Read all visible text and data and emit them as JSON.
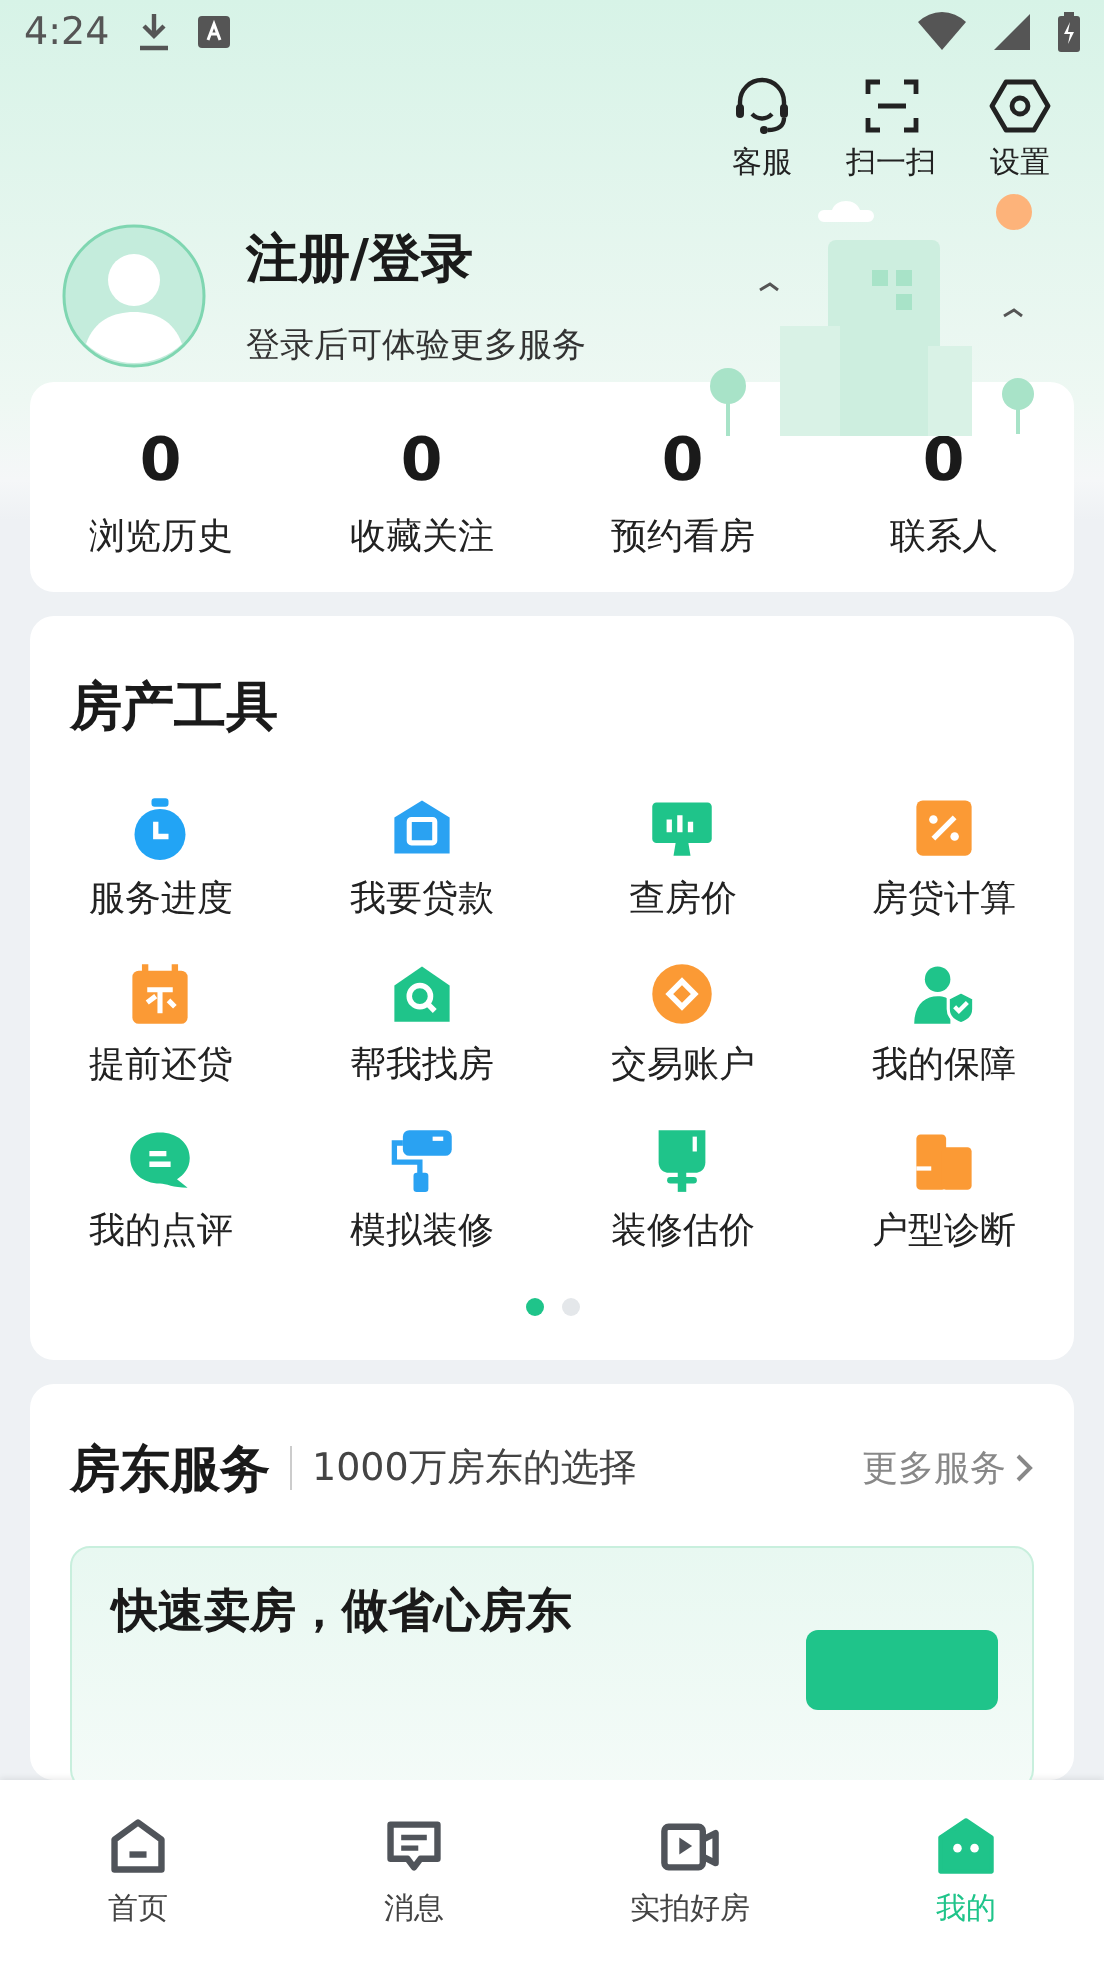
{
  "status_bar": {
    "time": "4:24"
  },
  "toolbar": [
    {
      "label": "客服"
    },
    {
      "label": "扫一扫"
    },
    {
      "label": "设置"
    }
  ],
  "profile": {
    "title": "注册/登录",
    "subtitle": "登录后可体验更多服务"
  },
  "stats": [
    {
      "value": "0",
      "label": "浏览历史"
    },
    {
      "value": "0",
      "label": "收藏关注"
    },
    {
      "value": "0",
      "label": "预约看房"
    },
    {
      "value": "0",
      "label": "联系人"
    }
  ],
  "tools": {
    "title": "房产工具",
    "items": [
      {
        "label": "服务进度"
      },
      {
        "label": "我要贷款"
      },
      {
        "label": "查房价"
      },
      {
        "label": "房贷计算"
      },
      {
        "label": "提前还贷"
      },
      {
        "label": "帮我找房"
      },
      {
        "label": "交易账户"
      },
      {
        "label": "我的保障"
      },
      {
        "label": "我的点评"
      },
      {
        "label": "模拟装修"
      },
      {
        "label": "装修估价"
      },
      {
        "label": "户型诊断"
      }
    ],
    "pages": [
      {
        "selected": true
      },
      {
        "selected": false
      }
    ]
  },
  "landlord": {
    "title": "房东服务",
    "subtitle": "1000万房东的选择",
    "more": "更多服务",
    "banner_title": "快速卖房，做省心房东"
  },
  "tab_bar": [
    {
      "label": "首页",
      "selected": false
    },
    {
      "label": "消息",
      "selected": false
    },
    {
      "label": "实拍好房",
      "selected": false
    },
    {
      "label": "我的",
      "selected": true
    }
  ]
}
